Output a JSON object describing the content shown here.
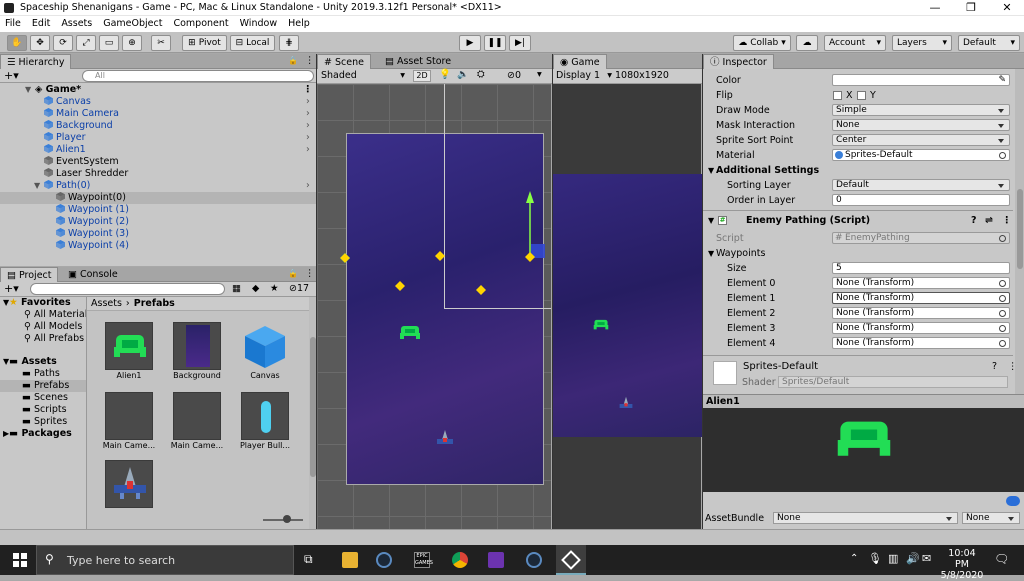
{
  "window": {
    "title": "Spaceship Shenanigans - Game - PC, Mac & Linux Standalone - Unity 2019.3.12f1 Personal* <DX11>"
  },
  "menu": [
    "File",
    "Edit",
    "Assets",
    "GameObject",
    "Component",
    "Window",
    "Help"
  ],
  "toolbar": {
    "pivot": "Pivot",
    "local": "Local",
    "collab": "Collab",
    "account": "Account",
    "layers": "Layers",
    "layout": "Default"
  },
  "hierarchy": {
    "tab": "Hierarchy",
    "search_placeholder": "All",
    "scene": "Game*",
    "items": [
      "Canvas",
      "Main Camera",
      "Background",
      "Player",
      "Alien1",
      "EventSystem",
      "Laser Shredder",
      "Path(0)"
    ],
    "children": [
      "Waypoint(0)",
      "Waypoint (1)",
      "Waypoint (2)",
      "Waypoint (3)",
      "Waypoint (4)"
    ]
  },
  "project": {
    "tab": "Project",
    "console_tab": "Console",
    "badge": "17",
    "favorites_label": "Favorites",
    "favorites": [
      "All Materials",
      "All Models",
      "All Prefabs"
    ],
    "assets_label": "Assets",
    "asset_folders": [
      "Paths",
      "Prefabs",
      "Scenes",
      "Scripts",
      "Sprites"
    ],
    "packages_label": "Packages",
    "breadcrumb_root": "Assets",
    "breadcrumb_current": "Prefabs",
    "prefabs": [
      "Alien1",
      "Background",
      "Canvas",
      "Main Came...",
      "Main Came...",
      "Player Bull..."
    ]
  },
  "scene": {
    "tab": "Scene",
    "asset_store_tab": "Asset Store",
    "shading": "Shaded",
    "mode_2d": "2D",
    "gizmo_count": "0"
  },
  "game": {
    "tab": "Game",
    "display": "Display 1",
    "resolution": "1080x1920"
  },
  "inspector": {
    "tab": "Inspector",
    "color_label": "Color",
    "flip_label": "Flip",
    "flip_x": "X",
    "flip_y": "Y",
    "draw_mode_label": "Draw Mode",
    "draw_mode": "Simple",
    "mask_label": "Mask Interaction",
    "mask": "None",
    "sort_point_label": "Sprite Sort Point",
    "sort_point": "Center",
    "material_label": "Material",
    "material": "Sprites-Default",
    "additional_label": "Additional Settings",
    "sorting_layer_label": "Sorting Layer",
    "sorting_layer": "Default",
    "order_label": "Order in Layer",
    "order": "0",
    "script_component": "Enemy Pathing (Script)",
    "script_label": "Script",
    "script": "EnemyPathing",
    "waypoints_label": "Waypoints",
    "size_label": "Size",
    "size": "5",
    "elements": [
      {
        "label": "Element 0",
        "value": "None (Transform)"
      },
      {
        "label": "Element 1",
        "value": "None (Transform)"
      },
      {
        "label": "Element 2",
        "value": "None (Transform)"
      },
      {
        "label": "Element 3",
        "value": "None (Transform)"
      },
      {
        "label": "Element 4",
        "value": "None (Transform)"
      }
    ],
    "material_asset": "Sprites-Default",
    "shader_label": "Shader",
    "shader": "Sprites/Default",
    "preview_title": "Alien1",
    "assetbundle_label": "AssetBundle",
    "assetbundle": "None",
    "assetbundle_variant": "None"
  },
  "taskbar": {
    "search_placeholder": "Type here to search",
    "time": "10:04 PM",
    "date": "5/8/2020"
  }
}
